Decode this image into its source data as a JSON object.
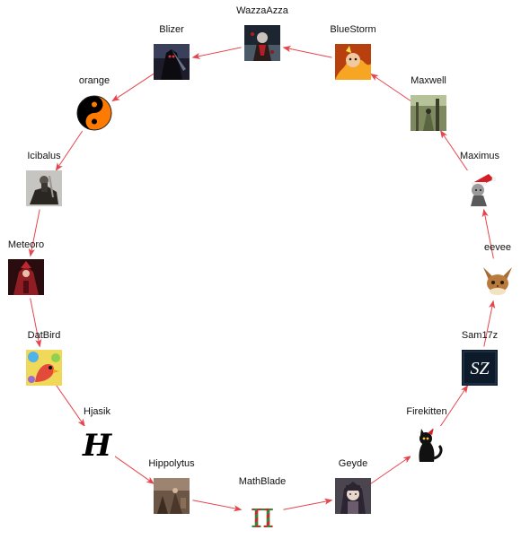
{
  "diagram": {
    "type": "cycle",
    "edge_color": "#e6454d",
    "nodes": [
      {
        "id": "wazzaazza",
        "label": "WazzaAzza",
        "avatar": "dark-figure-red-avatar"
      },
      {
        "id": "blizer",
        "label": "Blizer",
        "avatar": "shadow-warrior-avatar"
      },
      {
        "id": "orange",
        "label": "orange",
        "avatar": "yin-yang-icon",
        "colors": [
          "#ff7a00",
          "#000000"
        ]
      },
      {
        "id": "icibalus",
        "label": "Icibalus",
        "avatar": "knight-on-horse-avatar"
      },
      {
        "id": "meteoro",
        "label": "Meteoro",
        "avatar": "red-mage-avatar"
      },
      {
        "id": "datbird",
        "label": "DatBird",
        "avatar": "colorful-bird-avatar"
      },
      {
        "id": "hjasik",
        "label": "Hjasik",
        "avatar": "gothic-letter-h-icon",
        "glyph": "H"
      },
      {
        "id": "hippolytus",
        "label": "Hippolytus",
        "avatar": "painting-avatar"
      },
      {
        "id": "mathblade",
        "label": "MathBlade",
        "avatar": "pi-symbol-icon",
        "glyph": "π"
      },
      {
        "id": "geyde",
        "label": "Geyde",
        "avatar": "anime-girl-avatar"
      },
      {
        "id": "firekitten",
        "label": "Firekitten",
        "avatar": "black-cat-santa-hat-icon"
      },
      {
        "id": "sam17z",
        "label": "Sam17z",
        "avatar": "sz-logo-icon",
        "glyph": "SZ"
      },
      {
        "id": "eevee",
        "label": "eevee",
        "avatar": "eevee-avatar"
      },
      {
        "id": "maximus",
        "label": "Maximus",
        "avatar": "santa-hat-character-avatar"
      },
      {
        "id": "maxwell",
        "label": "Maxwell",
        "avatar": "forest-scene-avatar"
      },
      {
        "id": "bluestorm",
        "label": "BlueStorm",
        "avatar": "fiery-creature-avatar"
      }
    ],
    "edges": [
      [
        "wazzaazza",
        "blizer"
      ],
      [
        "blizer",
        "orange"
      ],
      [
        "orange",
        "icibalus"
      ],
      [
        "icibalus",
        "meteoro"
      ],
      [
        "meteoro",
        "datbird"
      ],
      [
        "datbird",
        "hjasik"
      ],
      [
        "hjasik",
        "hippolytus"
      ],
      [
        "hippolytus",
        "mathblade"
      ],
      [
        "mathblade",
        "geyde"
      ],
      [
        "geyde",
        "firekitten"
      ],
      [
        "firekitten",
        "sam17z"
      ],
      [
        "sam17z",
        "eevee"
      ],
      [
        "eevee",
        "maximus"
      ],
      [
        "maximus",
        "maxwell"
      ],
      [
        "maxwell",
        "bluestorm"
      ],
      [
        "bluestorm",
        "wazzaazza"
      ]
    ]
  }
}
